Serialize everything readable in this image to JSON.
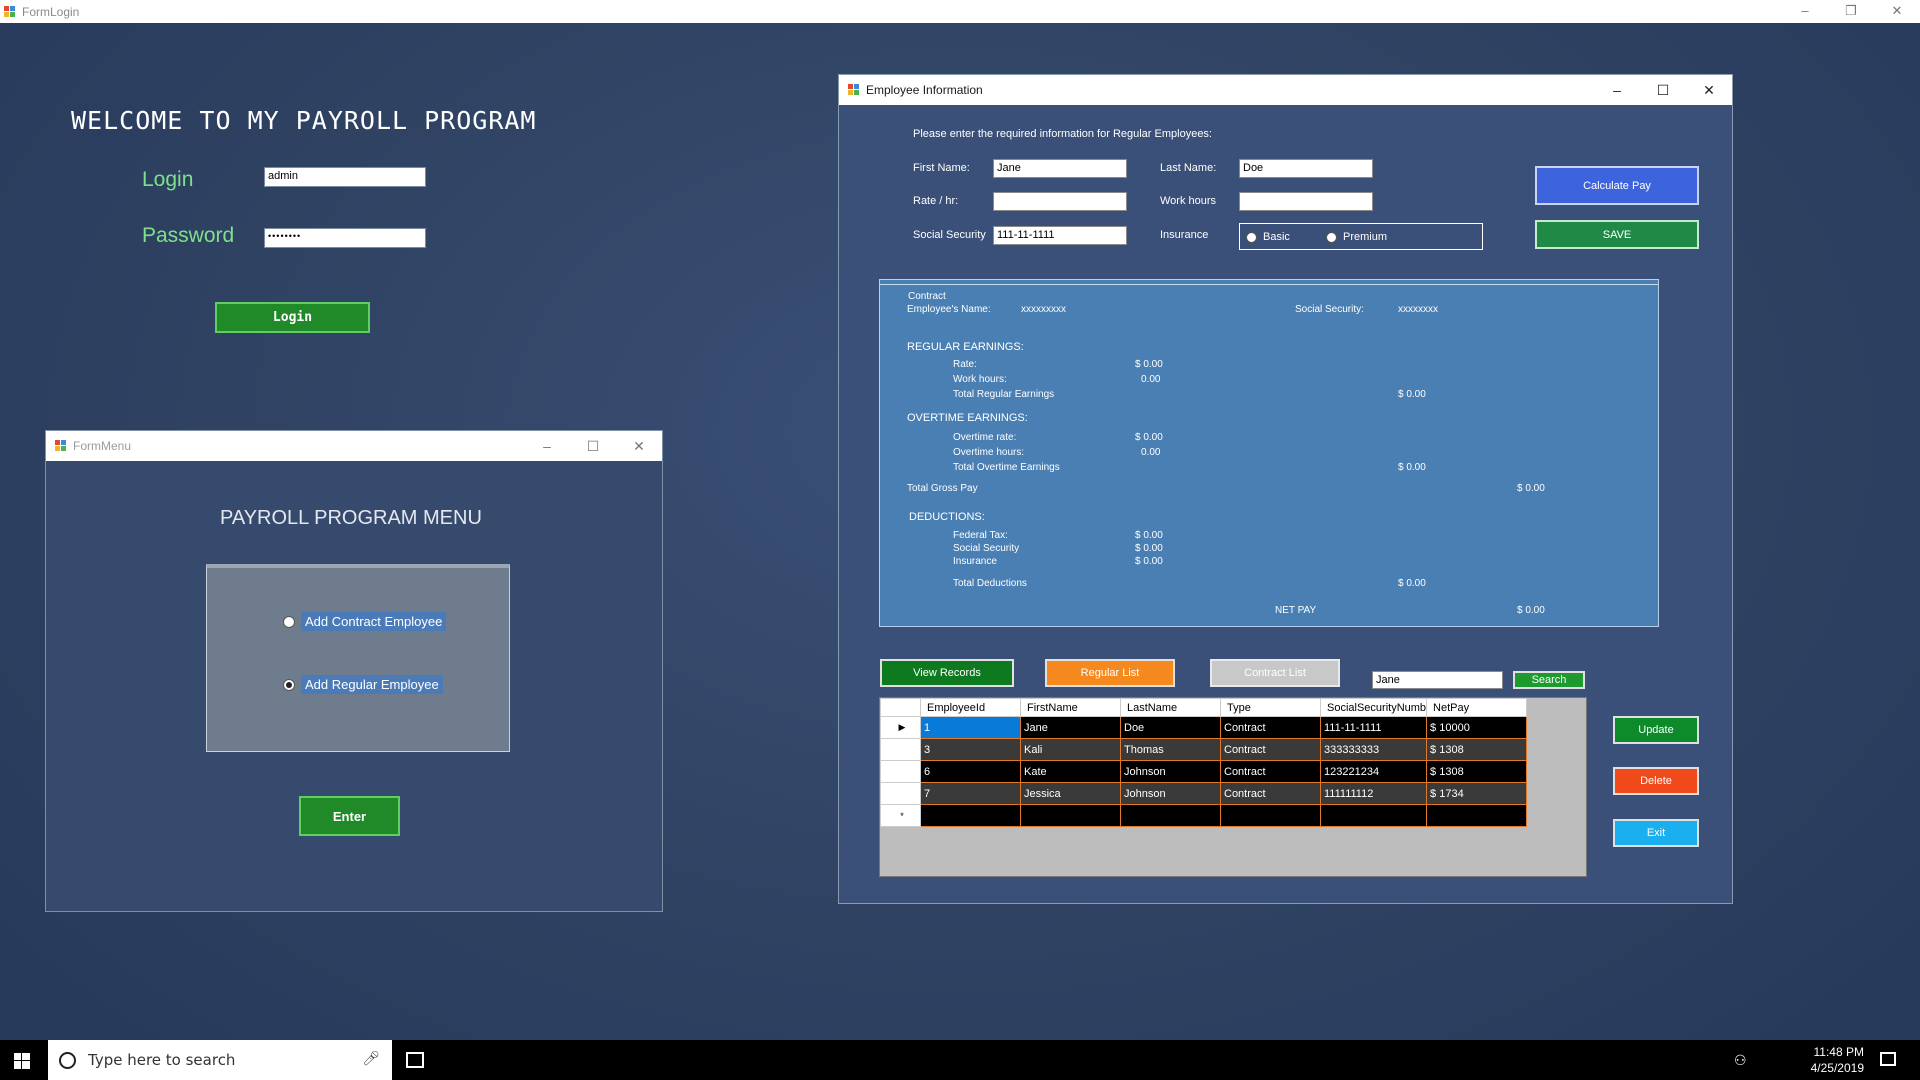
{
  "login_window": {
    "title": "FormLogin",
    "welcome": "WELCOME TO MY PAYROLL PROGRAM",
    "login_label": "Login",
    "password_label": "Password",
    "login_value": "admin",
    "password_value": "••••••••",
    "login_button": "Login"
  },
  "menu_window": {
    "title": "FormMenu",
    "heading": "PAYROLL PROGRAM MENU",
    "option_contract": "Add Contract Employee",
    "option_regular": "Add Regular Employee",
    "enter_button": "Enter"
  },
  "employee_window": {
    "title": "Employee Information",
    "instructions": "Please enter the required information for Regular Employees:",
    "first_name_label": "First Name:",
    "first_name_value": "Jane",
    "last_name_label": "Last Name:",
    "last_name_value": "Doe",
    "rate_label": "Rate / hr:",
    "rate_value": "",
    "work_hours_label": "Work hours",
    "work_hours_value": "",
    "ssn_label": "Social Security",
    "ssn_value": "111-11-1111",
    "insurance_label": "Insurance",
    "insurance_basic": "Basic",
    "insurance_premium": "Premium",
    "calculate_button": "Calculate Pay",
    "save_button": "SAVE",
    "report": {
      "type": "Contract",
      "employee_name_label": "Employee's Name:",
      "employee_name_value": "xxxxxxxxx",
      "ssn_label": "Social Security:",
      "ssn_value": "xxxxxxxx",
      "regular_heading": "REGULAR EARNINGS:",
      "rate_label": "Rate:",
      "rate_value": "$ 0.00",
      "work_hours_label": "Work hours:",
      "work_hours_value": "0.00",
      "total_regular_label": "Total Regular Earnings",
      "total_regular_value": "$ 0.00",
      "overtime_heading": "OVERTIME EARNINGS:",
      "ot_rate_label": "Overtime rate:",
      "ot_rate_value": "$ 0.00",
      "ot_hours_label": "Overtime hours:",
      "ot_hours_value": "0.00",
      "total_ot_label": "Total Overtime Earnings",
      "total_ot_value": "$ 0.00",
      "gross_label": "Total Gross Pay",
      "gross_value": "$ 0.00",
      "deductions_heading": "DEDUCTIONS:",
      "federal_label": "Federal Tax:",
      "federal_value": "$ 0.00",
      "ss_label": "Social Security",
      "ss_value": "$ 0.00",
      "insurance_label": "Insurance",
      "insurance_value": "$ 0.00",
      "total_deductions_label": "Total Deductions",
      "total_deductions_value": "$ 0.00",
      "net_label": "NET PAY",
      "net_value": "$ 0.00"
    },
    "view_records_button": "View Records",
    "regular_list_button": "Regular List",
    "contract_list_button": "Contract List",
    "search_value": "Jane",
    "search_button": "Search",
    "update_button": "Update",
    "delete_button": "Delete",
    "exit_button": "Exit",
    "grid": {
      "columns": [
        "EmployeeId",
        "FirstName",
        "LastName",
        "Type",
        "SocialSecurityNumb",
        "NetPay"
      ],
      "rows": [
        [
          "1",
          "Jane",
          "Doe",
          "Contract",
          "111-11-1111",
          "$ 10000"
        ],
        [
          "3",
          " Kali",
          "Thomas",
          "Contract",
          "333333333",
          "$ 1308"
        ],
        [
          "6",
          "Kate",
          "Johnson",
          "Contract",
          "123221234",
          "$ 1308"
        ],
        [
          "7",
          "Jessica",
          "Johnson",
          "Contract",
          "111111112",
          "$ 1734"
        ]
      ],
      "new_row_marker": "*",
      "current_row_marker": "▶"
    }
  },
  "taskbar": {
    "search_placeholder": "Type here to search",
    "time": "11:48 PM",
    "date": "4/25/2019"
  }
}
